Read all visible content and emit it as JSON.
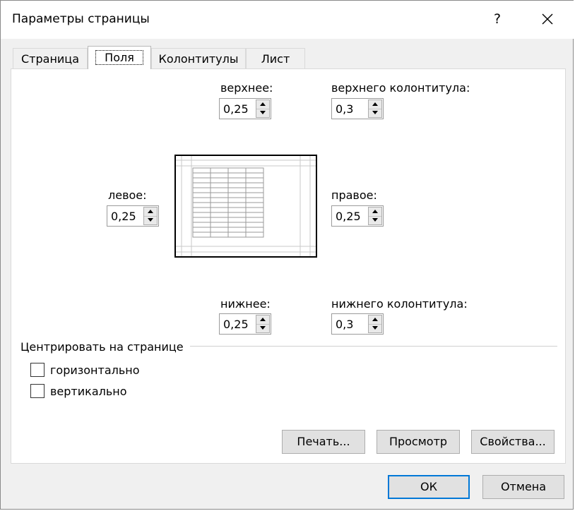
{
  "window": {
    "title": "Параметры страницы",
    "help_label": "?"
  },
  "tabs": [
    {
      "label": "Страница",
      "active": false
    },
    {
      "label": "Поля",
      "active": true
    },
    {
      "label": "Колонтитулы",
      "active": false
    },
    {
      "label": "Лист",
      "active": false
    }
  ],
  "margins": {
    "top": {
      "label": "верхнее:",
      "value": "0,25"
    },
    "header": {
      "label": "верхнего колонтитула:",
      "value": "0,3"
    },
    "left": {
      "label": "левое:",
      "value": "0,25"
    },
    "right": {
      "label": "правое:",
      "value": "0,25"
    },
    "bottom": {
      "label": "нижнее:",
      "value": "0,25"
    },
    "footer": {
      "label": "нижнего колонтитула:",
      "value": "0,3"
    }
  },
  "center_on_page": {
    "group_label": "Центрировать на странице",
    "horizontal": {
      "label": "горизонтально",
      "checked": false
    },
    "vertical": {
      "label": "вертикально",
      "checked": false
    }
  },
  "panel_buttons": {
    "print": "Печать...",
    "preview": "Просмотр",
    "properties": "Свойства..."
  },
  "dialog_buttons": {
    "ok": "ОК",
    "cancel": "Отмена"
  },
  "colors": {
    "default_button_border": "#0078d7",
    "dialog_background": "#f0f0f0"
  }
}
